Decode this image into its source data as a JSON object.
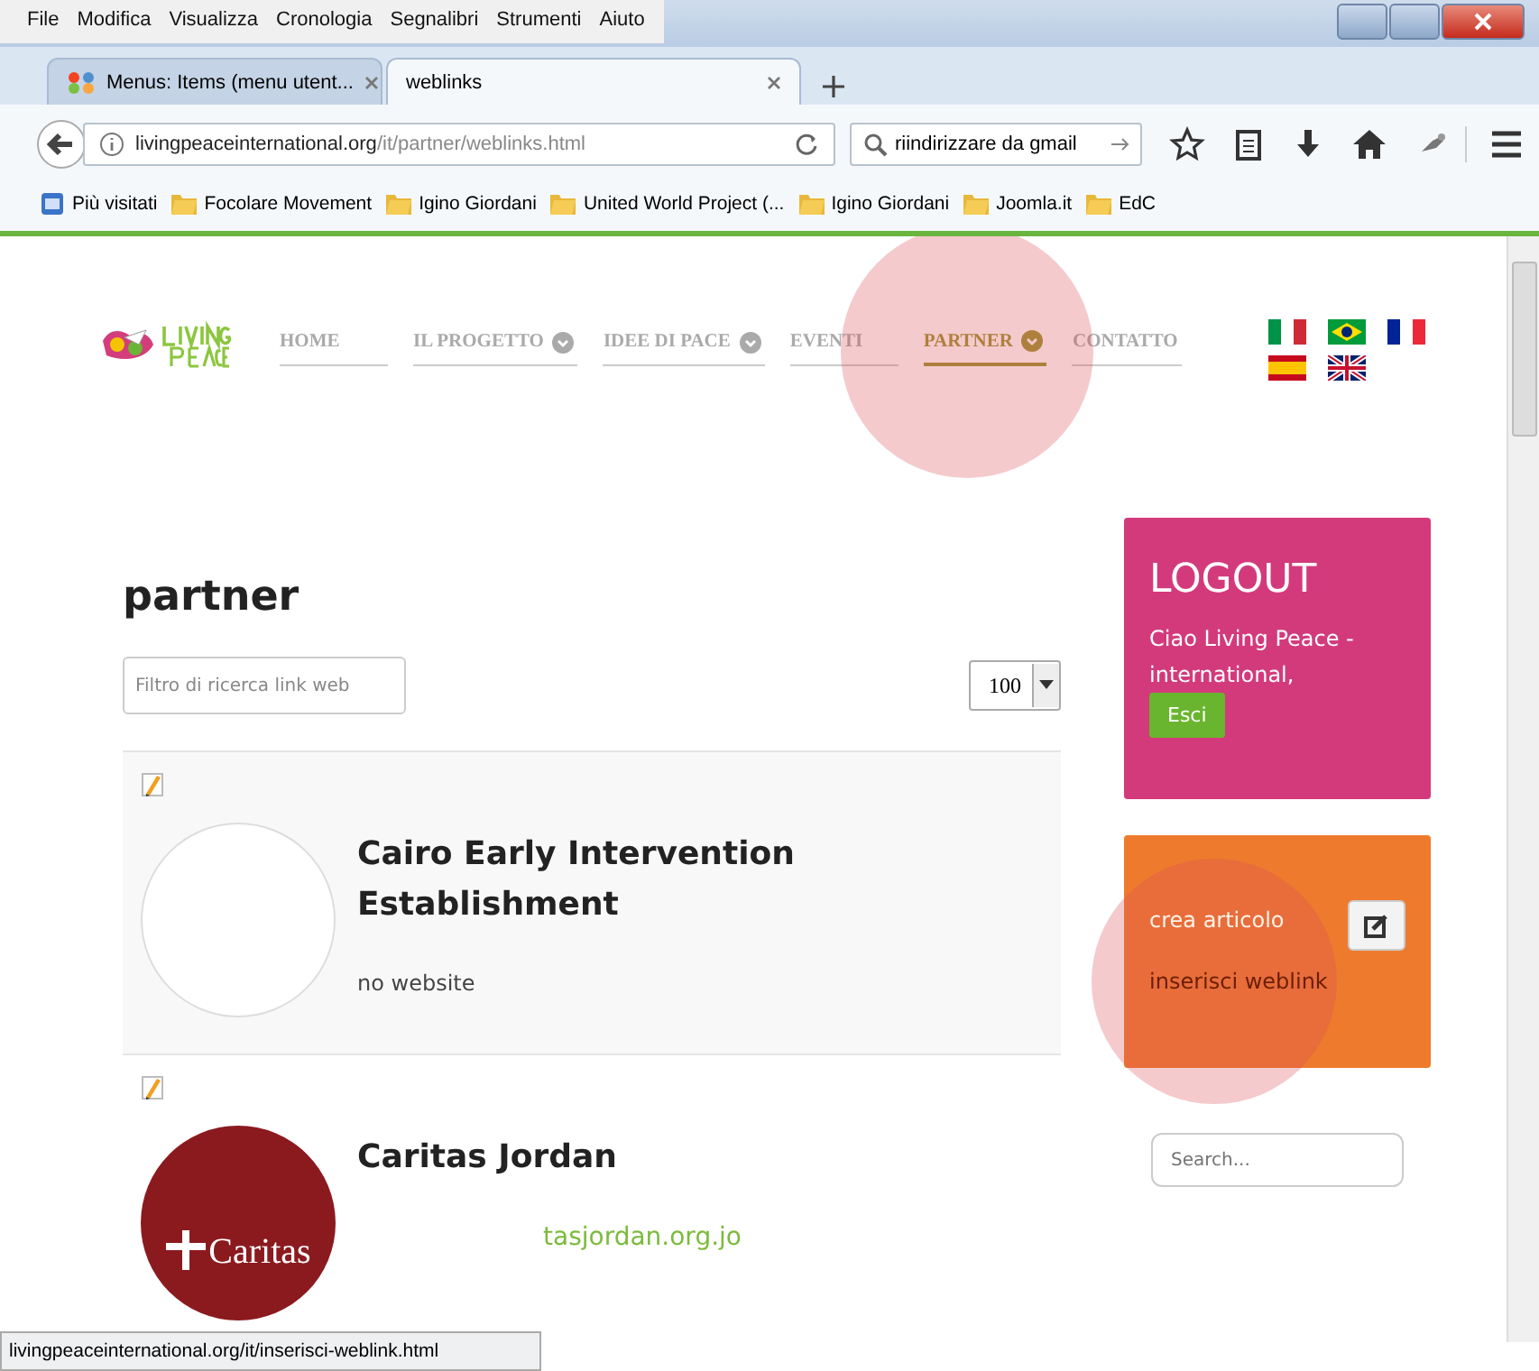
{
  "browser": {
    "menu": [
      "File",
      "Modifica",
      "Visualizza",
      "Cronologia",
      "Segnalibri",
      "Strumenti",
      "Aiuto"
    ],
    "tabs": [
      {
        "title": "Menus: Items (menu utent...",
        "selected": false,
        "kind": "joomla"
      },
      {
        "title": "weblinks",
        "selected": true,
        "kind": "plain"
      }
    ],
    "url": {
      "host": "livingpeaceinternational.org",
      "path": "/it/partner/weblinks.html"
    },
    "search": {
      "value": "riindirizzare da gmail"
    },
    "bookmarks": [
      {
        "label": "Più visitati",
        "kind": "page"
      },
      {
        "label": "Focolare Movement",
        "kind": "folder"
      },
      {
        "label": "Igino Giordani",
        "kind": "folder"
      },
      {
        "label": "United World Project (...",
        "kind": "folder"
      },
      {
        "label": "Igino Giordani",
        "kind": "folder"
      },
      {
        "label": "Joomla.it",
        "kind": "folder"
      },
      {
        "label": "EdC",
        "kind": "folder"
      }
    ],
    "status_url": "livingpeaceinternational.org/it/inserisci-weblink.html"
  },
  "page": {
    "nav": [
      {
        "label": "HOME",
        "dropdown": false,
        "selected": false
      },
      {
        "label": "IL PROGETTO",
        "dropdown": true,
        "selected": false
      },
      {
        "label": "IDEE DI PACE",
        "dropdown": true,
        "selected": false
      },
      {
        "label": "EVENTI",
        "dropdown": false,
        "selected": false
      },
      {
        "label": "PARTNER",
        "dropdown": true,
        "selected": true
      },
      {
        "label": "CONTATTO",
        "dropdown": false,
        "selected": false
      }
    ],
    "flags": [
      {
        "kind": "it"
      },
      {
        "kind": "br"
      },
      {
        "kind": "fr"
      },
      {
        "kind": "es"
      },
      {
        "kind": "gb"
      }
    ],
    "heading": "partner",
    "filter": {
      "placeholder": "Filtro di ricerca link web"
    },
    "limit": {
      "value": "100"
    },
    "links": [
      {
        "title": "Cairo Early Intervention Establishment",
        "website": "no website",
        "is_link": false,
        "logo": {
          "kind": "empty"
        }
      },
      {
        "title": "Caritas Jordan",
        "website": "tasjordan.org.jo",
        "is_link": true,
        "logo": {
          "kind": "caritas",
          "text": "Caritas"
        }
      }
    ],
    "logout": {
      "title": "LOGOUT",
      "greeting": "Ciao Living Peace - international,",
      "button": "Esci"
    },
    "tools": {
      "items": [
        "crea articolo",
        "inserisci weblink"
      ]
    },
    "search": {
      "placeholder": "Search..."
    }
  }
}
